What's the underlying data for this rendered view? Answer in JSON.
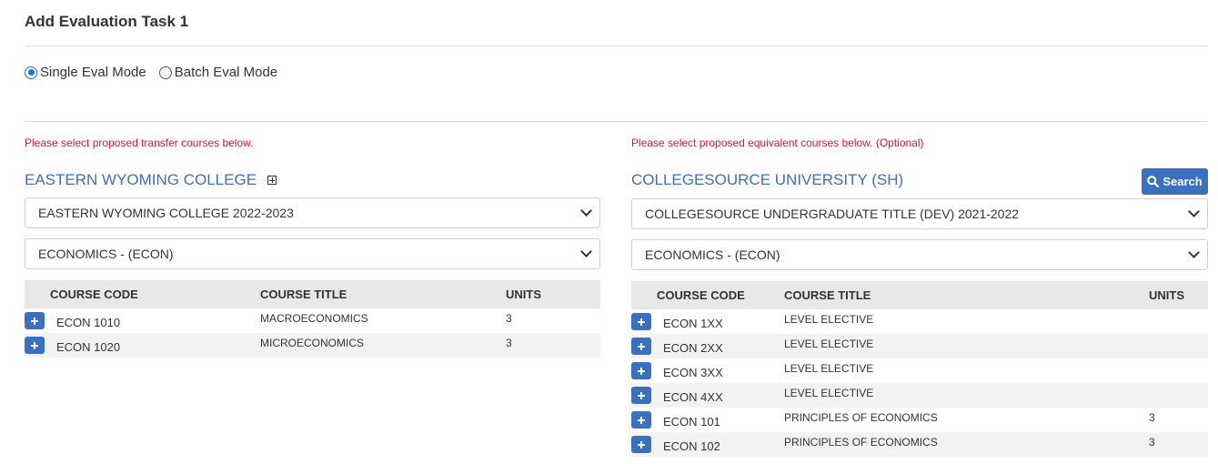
{
  "page": {
    "title": "Add Evaluation Task 1"
  },
  "modes": {
    "single_label": "Single Eval Mode",
    "batch_label": "Batch Eval Mode",
    "selected": "single"
  },
  "left": {
    "notice": "Please select proposed transfer courses below.",
    "institution": "EASTERN WYOMING COLLEGE",
    "catalog": "EASTERN WYOMING COLLEGE 2022-2023",
    "subject": "ECONOMICS - (ECON)",
    "headers": {
      "code": "COURSE CODE",
      "title": "COURSE TITLE",
      "units": "UNITS"
    },
    "courses": [
      {
        "code": "ECON 1010",
        "title": "MACROECONOMICS",
        "units": "3"
      },
      {
        "code": "ECON 1020",
        "title": "MICROECONOMICS",
        "units": "3"
      }
    ]
  },
  "right": {
    "notice": "Please select proposed equivalent courses below. (Optional)",
    "institution": "COLLEGESOURCE UNIVERSITY (SH)",
    "search_label": "Search",
    "catalog": "COLLEGESOURCE UNDERGRADUATE TITLE (DEV) 2021-2022",
    "subject": "ECONOMICS - (ECON)",
    "headers": {
      "code": "COURSE CODE",
      "title": "COURSE TITLE",
      "units": "UNITS"
    },
    "courses": [
      {
        "code": "ECON 1XX",
        "title": "LEVEL ELECTIVE",
        "units": ""
      },
      {
        "code": "ECON 2XX",
        "title": "LEVEL ELECTIVE",
        "units": ""
      },
      {
        "code": "ECON 3XX",
        "title": "LEVEL ELECTIVE",
        "units": ""
      },
      {
        "code": "ECON 4XX",
        "title": "LEVEL ELECTIVE",
        "units": ""
      },
      {
        "code": "ECON 101",
        "title": "PRINCIPLES OF ECONOMICS",
        "units": "3"
      },
      {
        "code": "ECON 102",
        "title": "PRINCIPLES OF ECONOMICS",
        "units": "3"
      }
    ]
  },
  "colors": {
    "accent": "#3b6fc0",
    "institution_text": "#3f6ebf",
    "notice_text": "#d9182d",
    "radio_selected": "#1a73e8"
  }
}
